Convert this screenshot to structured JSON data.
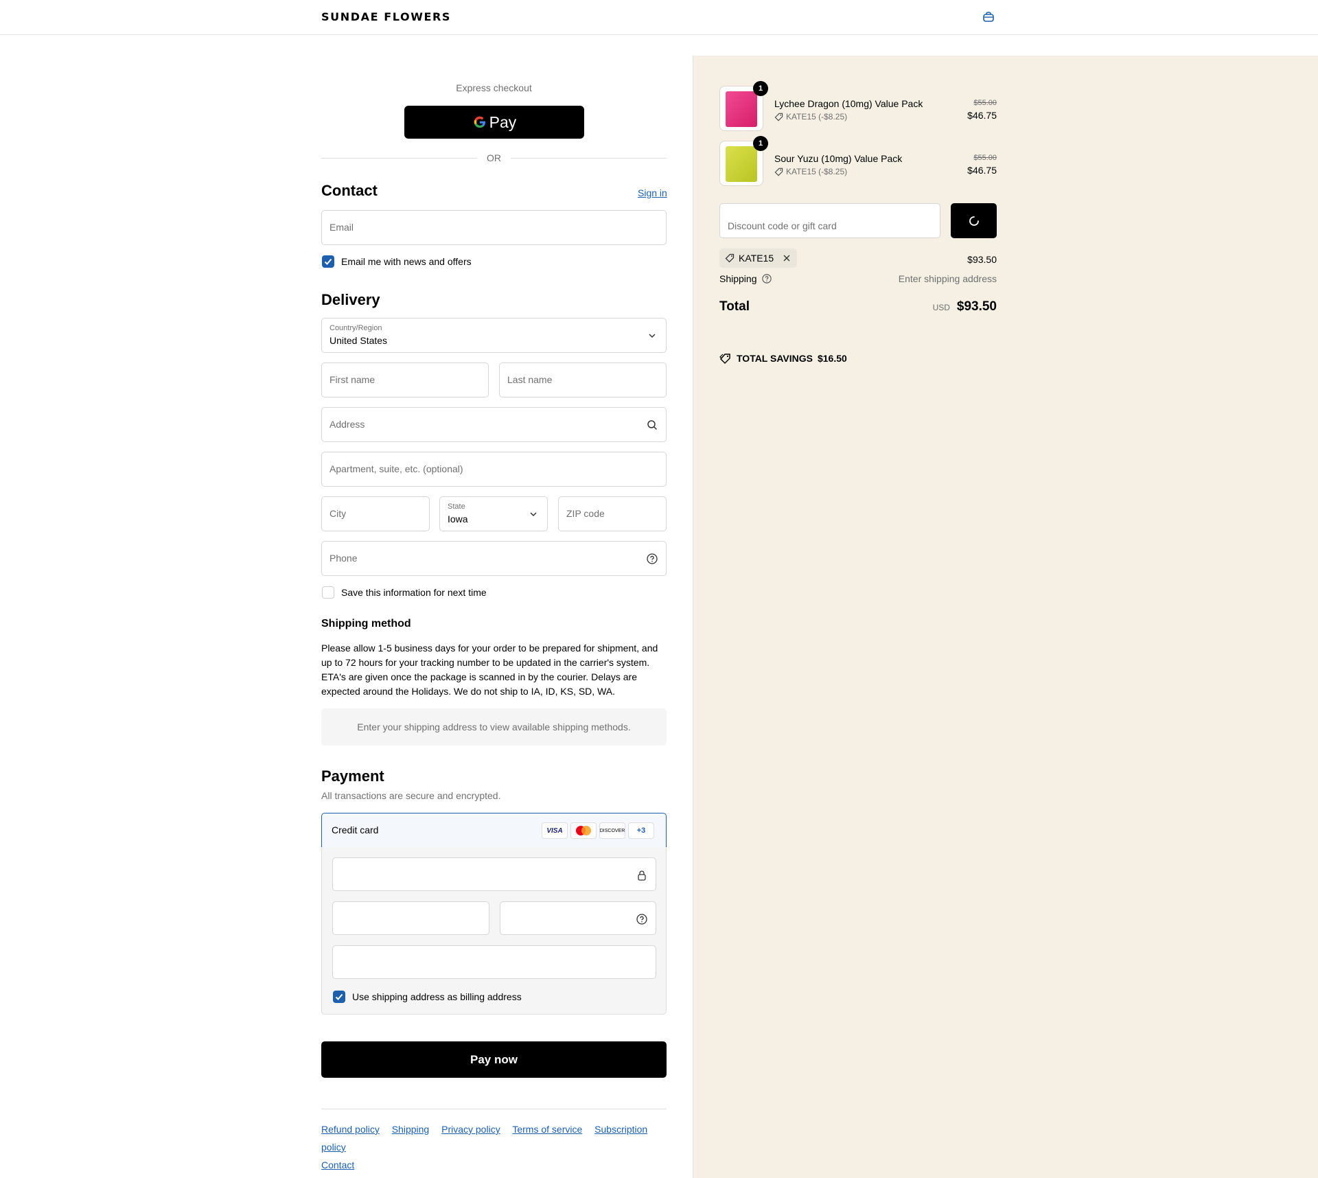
{
  "header": {
    "brand": "SUNDAE FLOWERS",
    "cart_icon": "bag-icon"
  },
  "express": {
    "title": "Express checkout",
    "gpay_label": "Pay",
    "or": "OR"
  },
  "contact": {
    "title": "Contact",
    "sign_in": "Sign in",
    "email_placeholder": "Email",
    "newsletter_label": "Email me with news and offers",
    "newsletter_checked": true
  },
  "delivery": {
    "title": "Delivery",
    "country_label": "Country/Region",
    "country_value": "United States",
    "first_name_placeholder": "First name",
    "last_name_placeholder": "Last name",
    "address_placeholder": "Address",
    "apartment_placeholder": "Apartment, suite, etc. (optional)",
    "city_placeholder": "City",
    "state_label": "State",
    "state_value": "Iowa",
    "zip_placeholder": "ZIP code",
    "phone_placeholder": "Phone",
    "save_info_label": "Save this information for next time",
    "save_info_checked": false
  },
  "shipping_method": {
    "title": "Shipping method",
    "note": "Please allow 1-5 business days for your order to be prepared for shipment, and up to 72 hours for your tracking number to be updated in the carrier's system. ETA's are given once the package is scanned in by the courier. Delays are expected around the Holidays. We do not ship to IA, ID, KS, SD, WA.",
    "placeholder_message": "Enter your shipping address to view available shipping methods."
  },
  "payment": {
    "title": "Payment",
    "subtitle": "All transactions are secure and encrypted.",
    "method_label": "Credit card",
    "card_logos": [
      "VISA",
      "DISCOVER",
      "+3"
    ],
    "billing_same_label": "Use shipping address as billing address",
    "billing_same_checked": true
  },
  "pay_now": "Pay now",
  "footer": {
    "links": [
      "Refund policy",
      "Shipping",
      "Privacy policy",
      "Terms of service",
      "Subscription policy",
      "Contact"
    ]
  },
  "order": {
    "items": [
      {
        "name": "Lychee Dragon (10mg) Value Pack",
        "qty": "1",
        "discount": "KATE15 (-$8.25)",
        "old_price": "$55.00",
        "price": "$46.75",
        "color": "#e8347e"
      },
      {
        "name": "Sour Yuzu (10mg) Value Pack",
        "qty": "1",
        "discount": "KATE15 (-$8.25)",
        "old_price": "$55.00",
        "price": "$46.75",
        "color": "#c8d42a"
      }
    ],
    "discount_placeholder": "Discount code or gift card",
    "applied_code": "KATE15",
    "subtotal": "$93.50",
    "shipping_label": "Shipping",
    "shipping_value": "Enter shipping address",
    "total_label": "Total",
    "currency": "USD",
    "total": "$93.50",
    "savings_label": "TOTAL SAVINGS",
    "savings_value": "$16.50"
  },
  "colors": {
    "accent": "#1c5fae",
    "panel": "#f5efe4"
  }
}
